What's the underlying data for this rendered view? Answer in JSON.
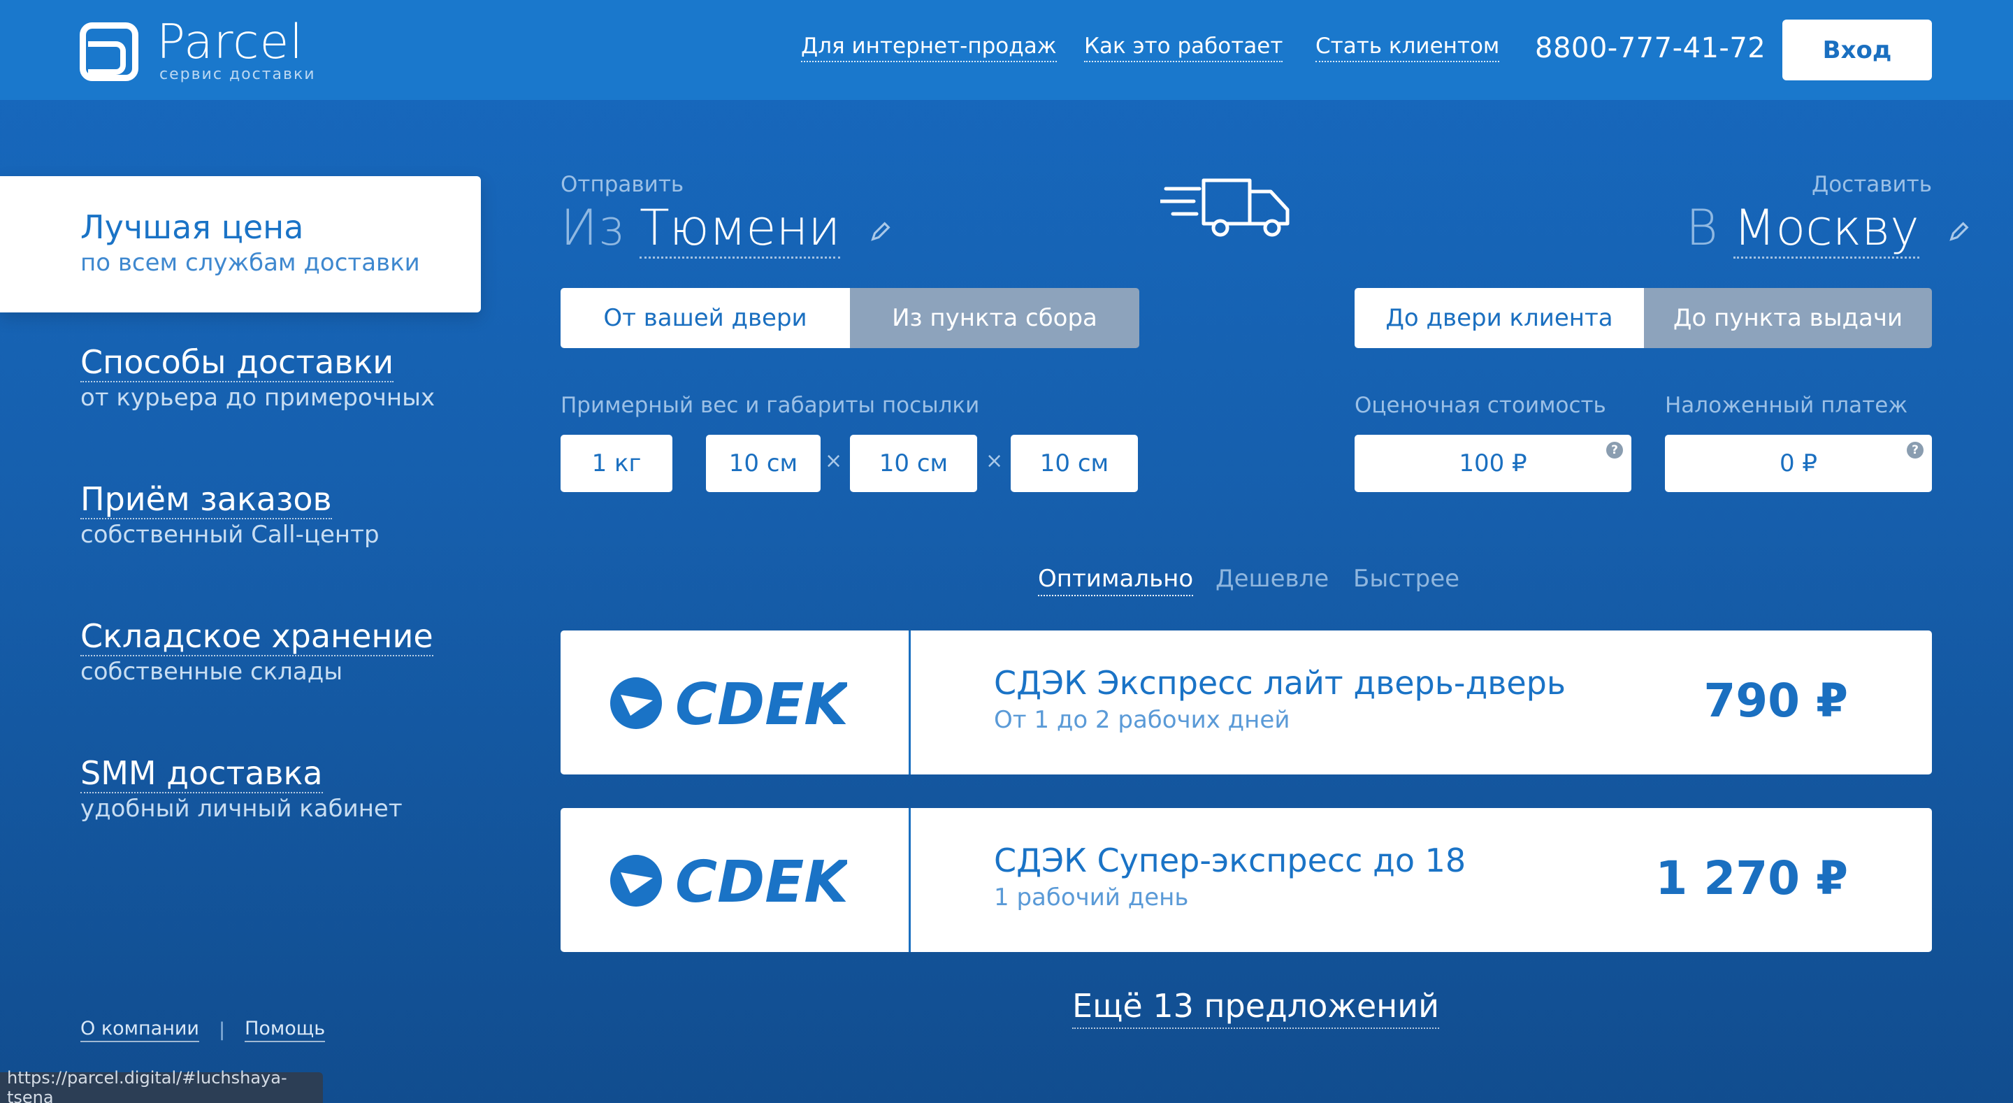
{
  "header": {
    "logo_name": "Parcel",
    "logo_tagline": "сервис доставки",
    "nav": [
      "Для интернет-продаж",
      "Как это работает",
      "Стать клиентом"
    ],
    "phone": "8800-777-41-72",
    "login": "Вход"
  },
  "sidebar": {
    "items": [
      {
        "title": "Лучшая цена",
        "subtitle": "по всем службам доставки",
        "active": true
      },
      {
        "title": "Способы доставки",
        "subtitle": "от курьера до примерочных"
      },
      {
        "title": "Приём заказов",
        "subtitle": "собственный Call-центр"
      },
      {
        "title": "Складское хранение",
        "subtitle": "собственные склады"
      },
      {
        "title": "SMM доставка",
        "subtitle": "удобный личный кабинет"
      }
    ],
    "footer": [
      "О компании",
      "Помощь"
    ]
  },
  "route": {
    "from_label": "Отправить",
    "from_prefix": "Из",
    "from_city": "Тюмени",
    "to_label": "Доставить",
    "to_prefix": "В",
    "to_city": "Москву"
  },
  "pickup_toggle": [
    "От вашей двери",
    "Из пункта сбора"
  ],
  "delivery_toggle": [
    "До двери клиента",
    "До пункта выдачи"
  ],
  "parcel": {
    "label": "Примерный вес и габариты посылки",
    "weight": "1 кг",
    "dims": [
      "10 см",
      "10 см",
      "10 см"
    ],
    "times": "×"
  },
  "valuation": {
    "label": "Оценочная стоимость",
    "value": "100 ₽",
    "help": "?"
  },
  "cod": {
    "label": "Наложенный платеж",
    "value": "0 ₽",
    "help": "?"
  },
  "sort": [
    "Оптимально",
    "Дешевле",
    "Быстрее"
  ],
  "offers": [
    {
      "brand": "CDEK",
      "title": "СДЭК Экспресс лайт дверь-дверь",
      "subtitle": "От 1 до 2 рабочих дней",
      "price": "790 ₽"
    },
    {
      "brand": "CDEK",
      "title": "СДЭК Супер-экспресс до 18",
      "subtitle": "1 рабочий день",
      "price": "1 270 ₽"
    }
  ],
  "more_offers": "Ещё 13 предложений",
  "status_url": "https://parcel.digital/#luchshaya-tsena",
  "colors": {
    "header": "#1a78cc",
    "background": "#165fad",
    "accent": "#1a6fc0",
    "toggle_off": "#8da3bc"
  }
}
